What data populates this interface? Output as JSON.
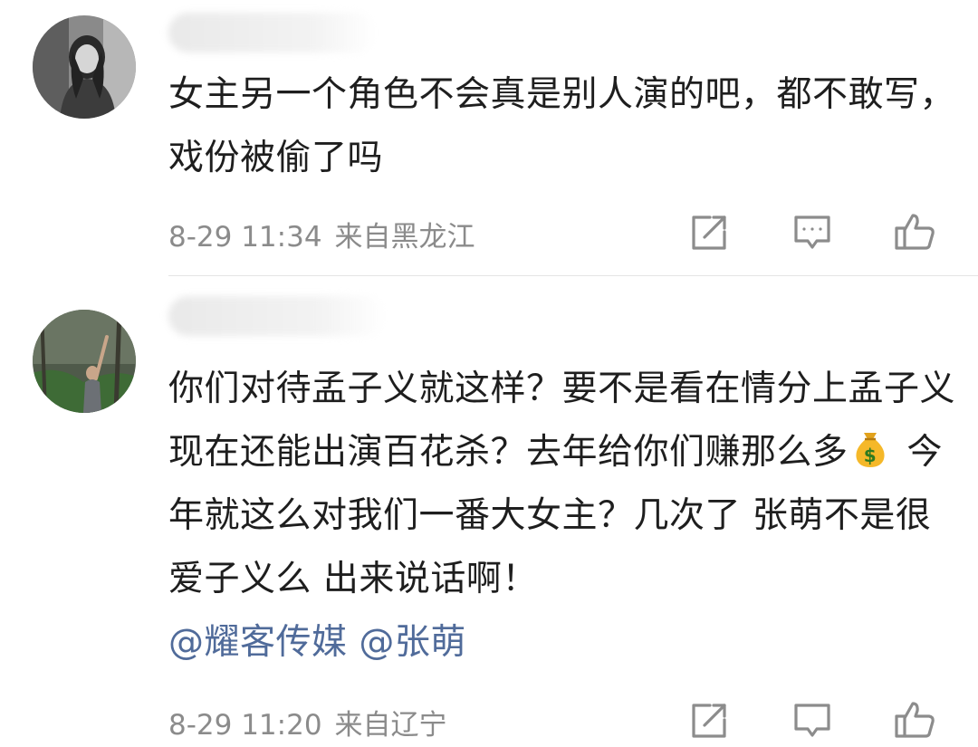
{
  "comments": [
    {
      "text": "女主另一个角色不会真是别人演的吧，都不敢写，戏份被偷了吗",
      "time": "8-29 11:34",
      "location": "来自黑龙江"
    },
    {
      "text_before_emoji": "你们对待孟子义就这样？要不是看在情分上孟子义现在还能出演百花杀？去年给你们赚那么多",
      "emoji": "money-bag",
      "text_after_emoji": " 今年就这么对我们一番大女主？几次了 张萌不是很爱子义么 出来说话啊！",
      "mentions": [
        "@耀客传媒",
        "@张萌"
      ],
      "time": "8-29 11:20",
      "location": "来自辽宁"
    }
  ],
  "icons": {
    "repost": "repost-icon",
    "comment": "comment-icon",
    "like": "like-icon"
  },
  "colors": {
    "mention": "#506b9a",
    "meta": "#8b8b8b",
    "icon": "#8c8c8c"
  }
}
